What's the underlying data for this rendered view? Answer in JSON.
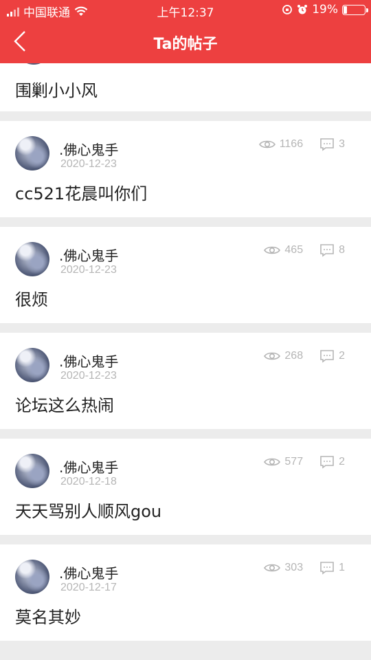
{
  "status_bar": {
    "carrier": "中国联通",
    "time": "上午12:37",
    "battery": "19%",
    "battery_level": 0.19
  },
  "nav": {
    "title": "Ta的帖子"
  },
  "first_post": {
    "content": "围剿小小风"
  },
  "posts": [
    {
      "author": ".佛心鬼手",
      "date": "2020-12-23",
      "views": "1166",
      "comments": "3",
      "content": "cc521花晨叫你们"
    },
    {
      "author": ".佛心鬼手",
      "date": "2020-12-23",
      "views": "465",
      "comments": "8",
      "content": "很烦"
    },
    {
      "author": ".佛心鬼手",
      "date": "2020-12-23",
      "views": "268",
      "comments": "2",
      "content": "论坛这么热闹"
    },
    {
      "author": ".佛心鬼手",
      "date": "2020-12-18",
      "views": "577",
      "comments": "2",
      "content": "天天骂别人顺风gou"
    },
    {
      "author": ".佛心鬼手",
      "date": "2020-12-17",
      "views": "303",
      "comments": "1",
      "content": "莫名其妙"
    }
  ],
  "colors": {
    "header": "#ed4040",
    "meta": "#b5b5b5",
    "background": "#ececec"
  }
}
